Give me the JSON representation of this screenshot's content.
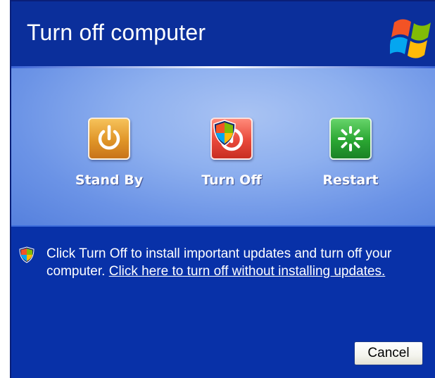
{
  "title_bar": {
    "title": "Turn off computer",
    "logo_icon": "windows-xp-flag-icon"
  },
  "options": [
    {
      "label": "Stand By",
      "icon": "power-icon",
      "color": "#e09528"
    },
    {
      "label": "Turn Off",
      "icon": "power-off-icon",
      "color": "#e8483a",
      "badge_icon": "security-shield-icon"
    },
    {
      "label": "Restart",
      "icon": "restart-icon",
      "color": "#2aa632"
    }
  ],
  "message": {
    "icon": "security-shield-icon",
    "text": "Click Turn Off to install important updates and turn off your computer.",
    "link_text": "Click here to turn off without installing updates."
  },
  "buttons": {
    "cancel_label": "Cancel"
  },
  "colors": {
    "dialog_background": "#0831a8",
    "content_band": "#8eb0ef",
    "text": "#ffffff"
  }
}
